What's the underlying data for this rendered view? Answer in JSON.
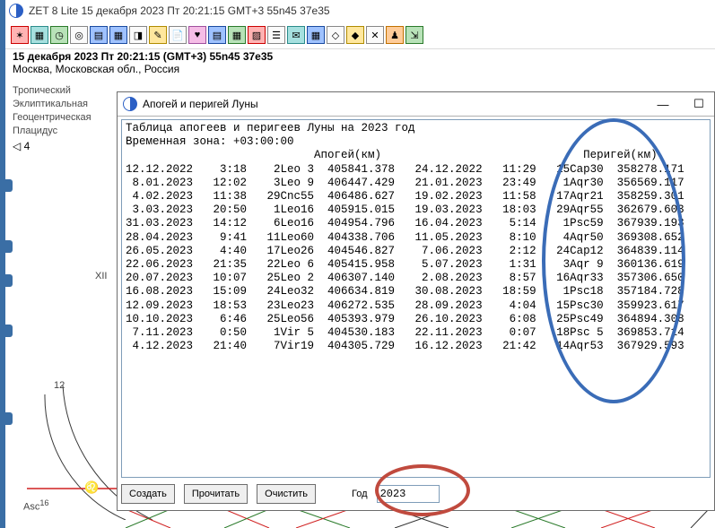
{
  "app": {
    "title": "ZET 8 Lite   15 декабря 2023   Пт   20:21:15 GMT+3 55n45  37e35"
  },
  "info": {
    "line1": "15 декабря 2023   Пт   20:21:15 (GMT+3)  55n45   37e35",
    "line2": "Москва, Московская обл., Россия"
  },
  "settings": {
    "r1": "Тропический",
    "r2": "Эклиптикальная",
    "r3": "Геоцентрическая",
    "r4": "Плацидус",
    "r5": "◁   4"
  },
  "chart_labels": {
    "xii": "XII",
    "twelve": "12",
    "asc": "Asc",
    "asc_deg": "16",
    "leo": "♌"
  },
  "dialog": {
    "title": "Апогей и перигей Луны",
    "header1": "Таблица апогеев и перигеев Луны на 2023 год",
    "header2": "Временная зона: +03:00:00",
    "header3": "                            Апогей(км)                              Перигей(км)",
    "buttons": {
      "create": "Создать",
      "read": "Прочитать",
      "clear": "Очистить"
    },
    "year_label": "Год",
    "year_value": "2023",
    "win": {
      "min": "—",
      "max": "☐"
    },
    "rows": [
      {
        "ad": "12.12.2022",
        "at": "3:18",
        "az": "2Leo 3",
        "ak": "405841.378",
        "pd": "24.12.2022",
        "pt": "11:29",
        "pz": "15Cap30",
        "pk": "358278.171"
      },
      {
        "ad": " 8.01.2023",
        "at": "12:02",
        "az": "3Leo 9",
        "ak": "406447.429",
        "pd": "21.01.2023",
        "pt": "23:49",
        "pz": "1Aqr30",
        "pk": "356569.117"
      },
      {
        "ad": " 4.02.2023",
        "at": "11:38",
        "az": "29Cnc55",
        "ak": "406486.627",
        "pd": "19.02.2023",
        "pt": "11:58",
        "pz": "17Aqr21",
        "pk": "358259.301"
      },
      {
        "ad": " 3.03.2023",
        "at": "20:50",
        "az": "1Leo16",
        "ak": "405915.015",
        "pd": "19.03.2023",
        "pt": "18:03",
        "pz": "29Aqr55",
        "pk": "362679.603"
      },
      {
        "ad": "31.03.2023",
        "at": "14:12",
        "az": "6Leo16",
        "ak": "404954.796",
        "pd": "16.04.2023",
        "pt": "5:14",
        "pz": "1Psc59",
        "pk": "367939.193"
      },
      {
        "ad": "28.04.2023",
        "at": "9:41",
        "az": "11Leo60",
        "ak": "404338.706",
        "pd": "11.05.2023",
        "pt": "8:10",
        "pz": "4Aqr50",
        "pk": "369308.652"
      },
      {
        "ad": "26.05.2023",
        "at": "4:40",
        "az": "17Leo26",
        "ak": "404546.827",
        "pd": " 7.06.2023",
        "pt": "2:12",
        "pz": "24Cap12",
        "pk": "364839.114"
      },
      {
        "ad": "22.06.2023",
        "at": "21:35",
        "az": "22Leo 6",
        "ak": "405415.958",
        "pd": " 5.07.2023",
        "pt": "1:31",
        "pz": "3Aqr 9",
        "pk": "360136.619"
      },
      {
        "ad": "20.07.2023",
        "at": "10:07",
        "az": "25Leo 2",
        "ak": "406307.140",
        "pd": " 2.08.2023",
        "pt": "8:57",
        "pz": "16Aqr33",
        "pk": "357306.650"
      },
      {
        "ad": "16.08.2023",
        "at": "15:09",
        "az": "24Leo32",
        "ak": "406634.819",
        "pd": "30.08.2023",
        "pt": "18:59",
        "pz": "1Psc18",
        "pk": "357184.728"
      },
      {
        "ad": "12.09.2023",
        "at": "18:53",
        "az": "23Leo23",
        "ak": "406272.535",
        "pd": "28.09.2023",
        "pt": "4:04",
        "pz": "15Psc30",
        "pk": "359923.617"
      },
      {
        "ad": "10.10.2023",
        "at": "6:46",
        "az": "25Leo56",
        "ak": "405393.979",
        "pd": "26.10.2023",
        "pt": "6:08",
        "pz": "25Psc49",
        "pk": "364894.308"
      },
      {
        "ad": " 7.11.2023",
        "at": "0:50",
        "az": "1Vir 5",
        "ak": "404530.183",
        "pd": "22.11.2023",
        "pt": "0:07",
        "pz": "18Psc 5",
        "pk": "369853.714"
      },
      {
        "ad": " 4.12.2023",
        "at": "21:40",
        "az": "7Vir19",
        "ak": "404305.729",
        "pd": "16.12.2023",
        "pt": "21:42",
        "pz": "14Aqr53",
        "pk": "367929.593"
      }
    ]
  }
}
